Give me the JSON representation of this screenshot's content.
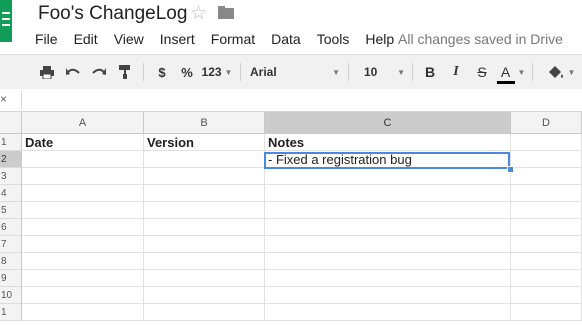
{
  "header": {
    "title": "Foo's ChangeLog",
    "save_status": "All changes saved in Drive"
  },
  "menu": [
    "File",
    "Edit",
    "View",
    "Insert",
    "Format",
    "Data",
    "Tools",
    "Help"
  ],
  "toolbar": {
    "currency": "$",
    "percent": "%",
    "number_format": "123",
    "font": "Arial",
    "font_size": "10",
    "bold": "B",
    "italic": "I",
    "strike": "S",
    "text_color": "A"
  },
  "formula_bar": {
    "close": "×"
  },
  "columns": [
    "A",
    "B",
    "C",
    "D"
  ],
  "rows": [
    "1",
    "2",
    "3",
    "4",
    "5",
    "6",
    "7",
    "8",
    "9",
    "10",
    "1"
  ],
  "cells": {
    "a1": "Date",
    "b1": "Version",
    "c1": "Notes",
    "c2": "- Fixed a registration bug"
  },
  "colors": {
    "brand_green": "#0f9d58",
    "selection_blue": "#4a89dc",
    "text_color_bar": "#000000"
  }
}
